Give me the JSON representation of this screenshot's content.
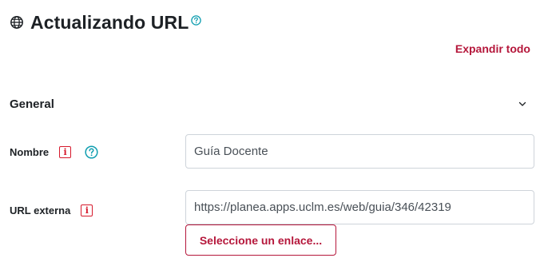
{
  "header": {
    "title": "Actualizando URL",
    "title_icon": "globe-icon",
    "help_icon": "question-circle-icon"
  },
  "actions": {
    "expand_all_label": "Expandir todo"
  },
  "section": {
    "title": "General",
    "toggle_icon": "chevron-down-icon"
  },
  "fields": {
    "name": {
      "label": "Nombre",
      "required_icon": "required-info-icon",
      "help_icon": "question-circle-icon",
      "value": "Guía Docente"
    },
    "external_url": {
      "label": "URL externa",
      "required_icon": "required-info-icon",
      "value": "https://planea.apps.uclm.es/web/guia/346/42319"
    }
  },
  "buttons": {
    "select_link_label": "Seleccione un enlace..."
  },
  "colors": {
    "accent": "#b5173b",
    "required": "#d6192c",
    "help": "#0f9eb0",
    "text": "#1d2125",
    "input_border": "#ced4da"
  }
}
